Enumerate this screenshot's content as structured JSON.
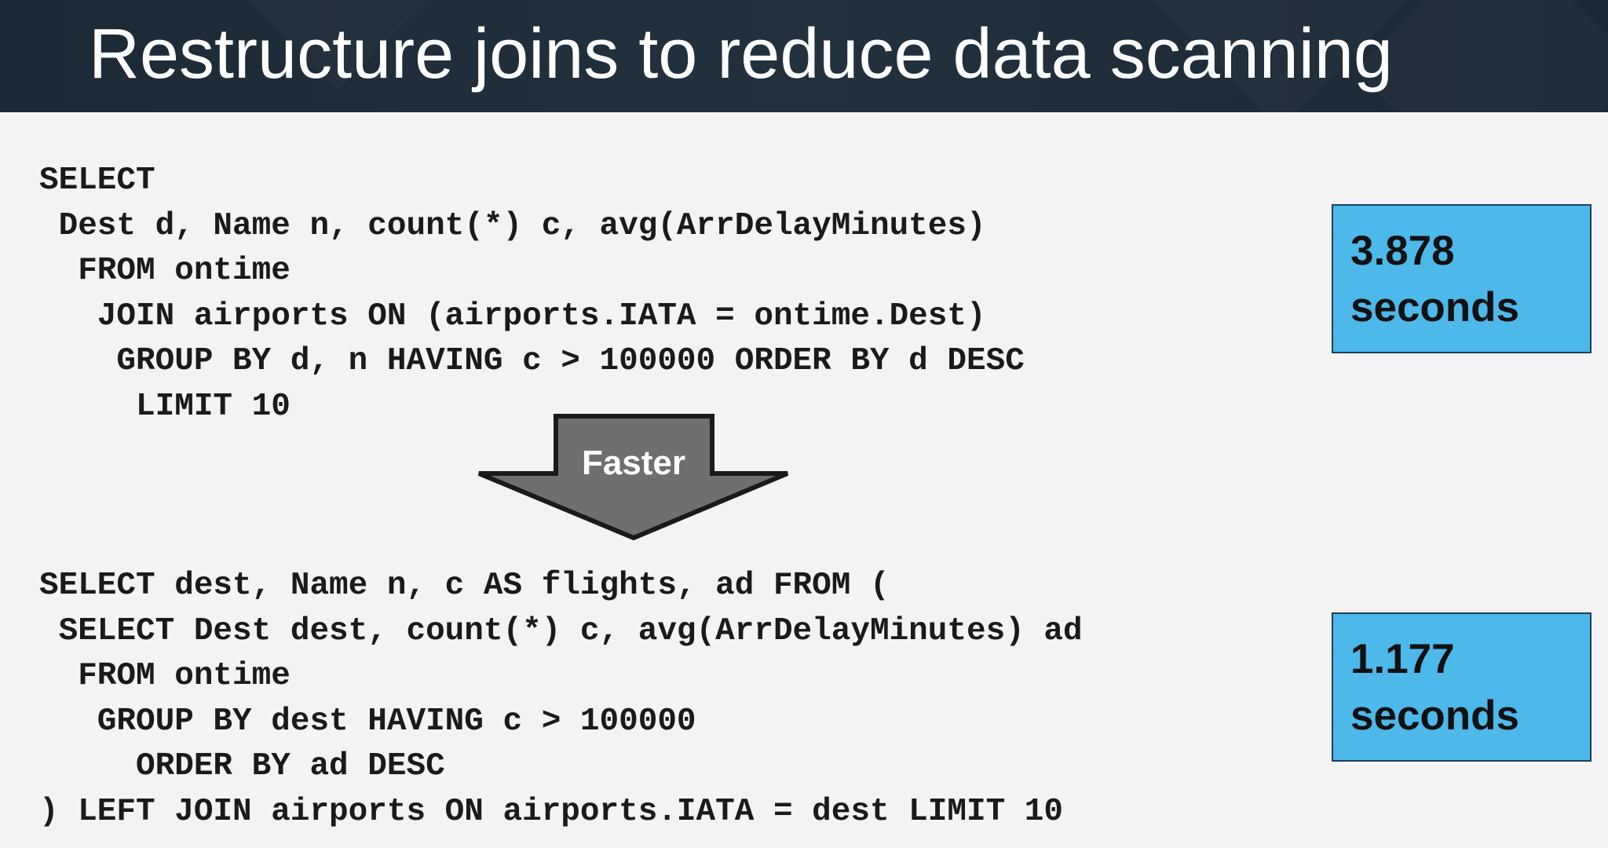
{
  "slide": {
    "title": "Restructure joins to reduce data scanning"
  },
  "query_before": {
    "lines": [
      "SELECT",
      " Dest d, Name n, count(*) c, avg(ArrDelayMinutes)",
      "  FROM ontime",
      "   JOIN airports ON (airports.IATA = ontime.Dest)",
      "    GROUP BY d, n HAVING c > 100000 ORDER BY d DESC",
      "     LIMIT 10"
    ],
    "timing": {
      "value": "3.878",
      "unit": "seconds"
    }
  },
  "arrow": {
    "label": "Faster",
    "fill_color": "#6f6f6f",
    "stroke_color": "#1a1a1a"
  },
  "query_after": {
    "lines": [
      "SELECT dest, Name n, c AS flights, ad FROM (",
      " SELECT Dest dest, count(*) c, avg(ArrDelayMinutes) ad",
      "  FROM ontime",
      "   GROUP BY dest HAVING c > 100000",
      "     ORDER BY ad DESC",
      ") LEFT JOIN airports ON airports.IATA = dest LIMIT 10"
    ],
    "timing": {
      "value": "1.177",
      "unit": "seconds"
    }
  },
  "colors": {
    "header_bg": "#1c2a36",
    "slide_bg": "#f3f3f3",
    "timing_box": "#4db8ea"
  }
}
